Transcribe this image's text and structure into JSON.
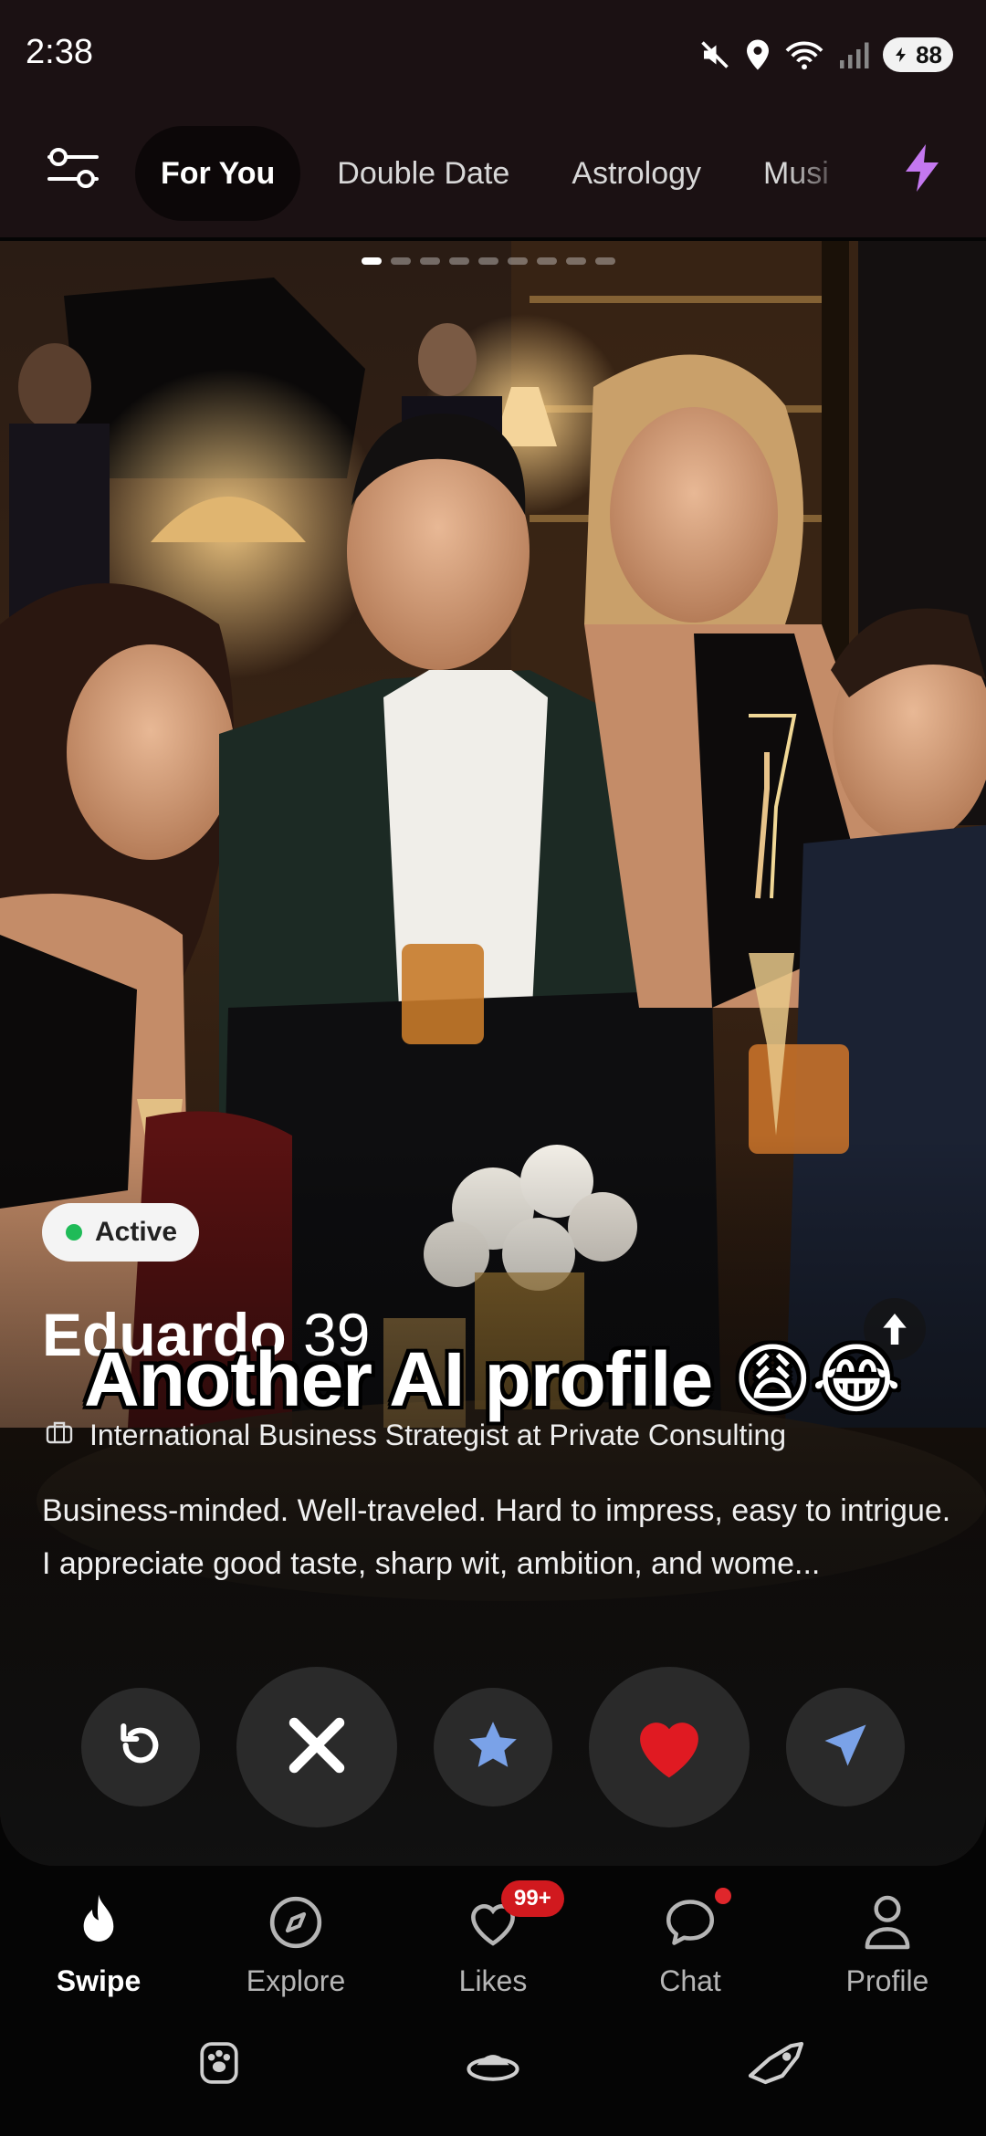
{
  "status_bar": {
    "time": "2:38",
    "battery_level": "88",
    "icons": [
      "mute-icon",
      "location-icon",
      "wifi-icon",
      "signal-icon",
      "battery-icon"
    ]
  },
  "top_tabs": {
    "filter_icon": "sliders-icon",
    "boost_icon": "lightning-icon",
    "items": [
      {
        "label": "For You",
        "active": true
      },
      {
        "label": "Double Date",
        "active": false
      },
      {
        "label": "Astrology",
        "active": false
      },
      {
        "label": "Musi",
        "active": false
      }
    ]
  },
  "card": {
    "photo_index": 1,
    "photo_count": 9,
    "active_label": "Active",
    "name": "Eduardo",
    "age": "39",
    "overlay_caption": "Another AI profile 😩😂",
    "job": "International Business Strategist at Private Consulting",
    "bio_line1": "Business-minded. Well-traveled. Hard to impress, easy to intrigue.",
    "bio_line2": "I appreciate good taste, sharp wit, ambition, and wome..."
  },
  "actions": {
    "rewind_icon": "rewind-icon",
    "nope_icon": "x-icon",
    "super_like_icon": "star-icon",
    "like_icon": "heart-icon",
    "boost_icon": "send-icon"
  },
  "bottom_nav": {
    "items": [
      {
        "label": "Swipe",
        "icon": "flame-icon",
        "active": true
      },
      {
        "label": "Explore",
        "icon": "compass-icon",
        "active": false
      },
      {
        "label": "Likes",
        "icon": "heart-outline-icon",
        "active": false,
        "badge": "99+"
      },
      {
        "label": "Chat",
        "icon": "chat-bubble-icon",
        "active": false
      },
      {
        "label": "Profile",
        "icon": "person-icon",
        "active": false
      }
    ]
  },
  "system_row": {
    "icons": [
      "paw-icon",
      "pet-bowl-icon",
      "rocket-cat-icon"
    ]
  },
  "colors": {
    "background": "#050505",
    "top_bar": "#1b1113",
    "like_red": "#e01a22",
    "star_blue": "#7aa2e8",
    "boost_purple": "#c478f0",
    "active_green": "#1fbb58",
    "badge_red": "#d1191e"
  }
}
